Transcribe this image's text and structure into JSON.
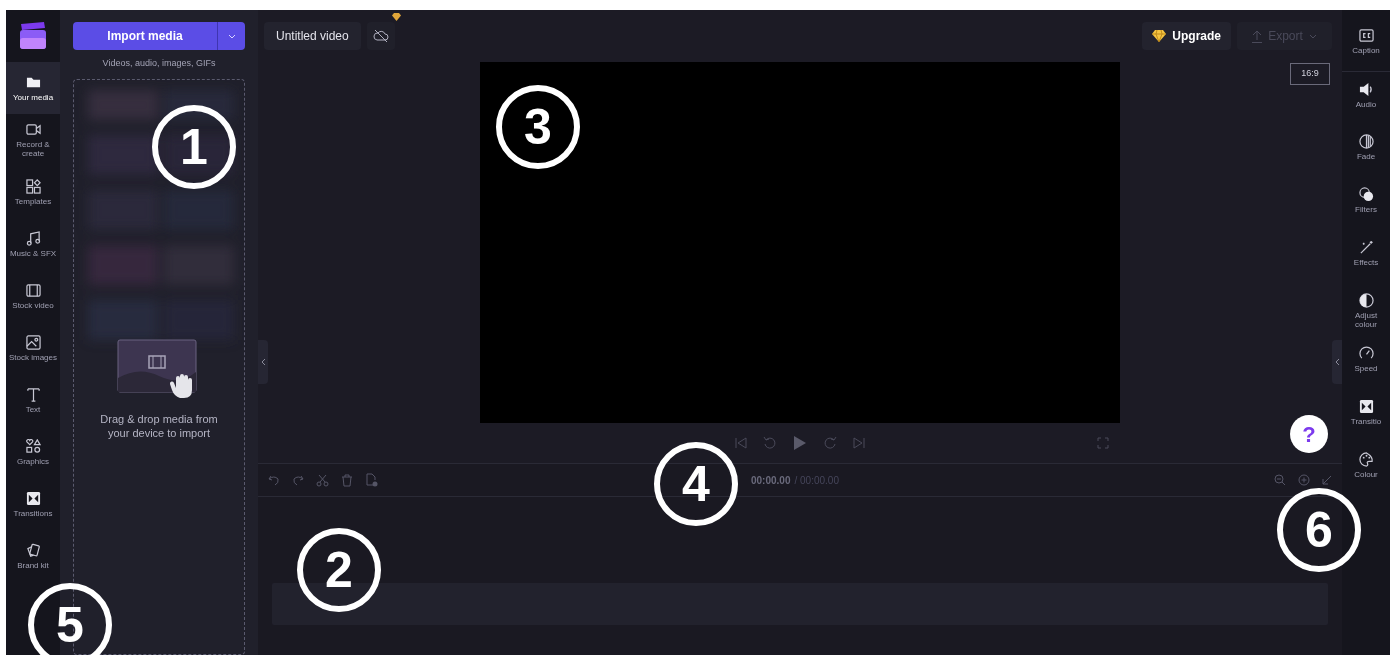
{
  "left_nav": {
    "items": [
      {
        "label": "Your media",
        "selected": true
      },
      {
        "label": "Record & create",
        "selected": false
      },
      {
        "label": "Templates",
        "selected": false
      },
      {
        "label": "Music & SFX",
        "selected": false
      },
      {
        "label": "Stock video",
        "selected": false
      },
      {
        "label": "Stock images",
        "selected": false
      },
      {
        "label": "Text",
        "selected": false
      },
      {
        "label": "Graphics",
        "selected": false
      },
      {
        "label": "Transitions",
        "selected": false
      },
      {
        "label": "Brand kit",
        "selected": false
      }
    ]
  },
  "media_panel": {
    "import_button": "Import media",
    "hint": "Videos, audio, images, GIFs",
    "drop_text": "Drag & drop media from your device to import"
  },
  "top_bar": {
    "project_title": "Untitled video",
    "upgrade_button": "Upgrade",
    "export_button": {
      "label": "Export",
      "disabled": true
    }
  },
  "preview": {
    "aspect_ratio": "16:9"
  },
  "help_button": "?",
  "timeline": {
    "current_time": "00:00.00",
    "total_time": "/ 00:00.00"
  },
  "right_panel": {
    "items": [
      {
        "label": "Caption"
      },
      {
        "label": "Audio"
      },
      {
        "label": "Fade"
      },
      {
        "label": "Filters"
      },
      {
        "label": "Effects"
      },
      {
        "label": "Adjust colour"
      },
      {
        "label": "Speed"
      },
      {
        "label": "Transitio"
      },
      {
        "label": "Colour"
      }
    ]
  },
  "callouts": [
    "1",
    "2",
    "3",
    "4",
    "5",
    "6"
  ]
}
